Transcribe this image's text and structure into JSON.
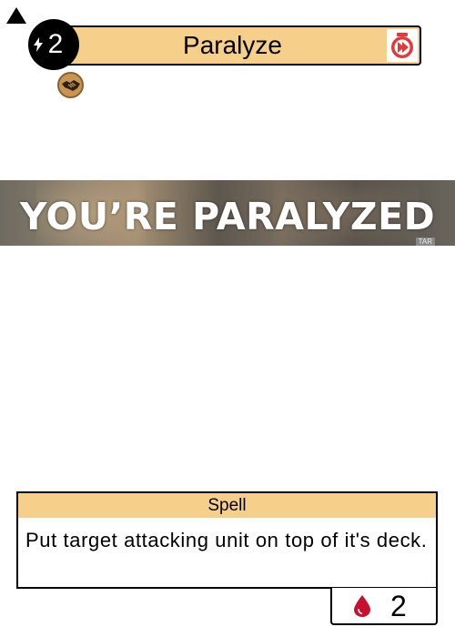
{
  "card": {
    "name": "Paralyze",
    "mana_cost": "2",
    "type": "Spell",
    "rules_text": "Put target attacking unit on top of it's deck.",
    "cost_value": "2",
    "art_caption": "YOU’RE PARALYZED",
    "art_tag": "TAR",
    "icons": {
      "mana": "lightning-bolt-icon",
      "speed": "fast-speed-icon",
      "keyword": "handshake-icon",
      "cost": "blood-drop-icon",
      "marker": "triangle-icon"
    }
  },
  "colors": {
    "banner": "#f6cf8a",
    "speed_icon": "#e23a3a",
    "keyword_icon": "#c99553",
    "blood": "#c8102e"
  }
}
